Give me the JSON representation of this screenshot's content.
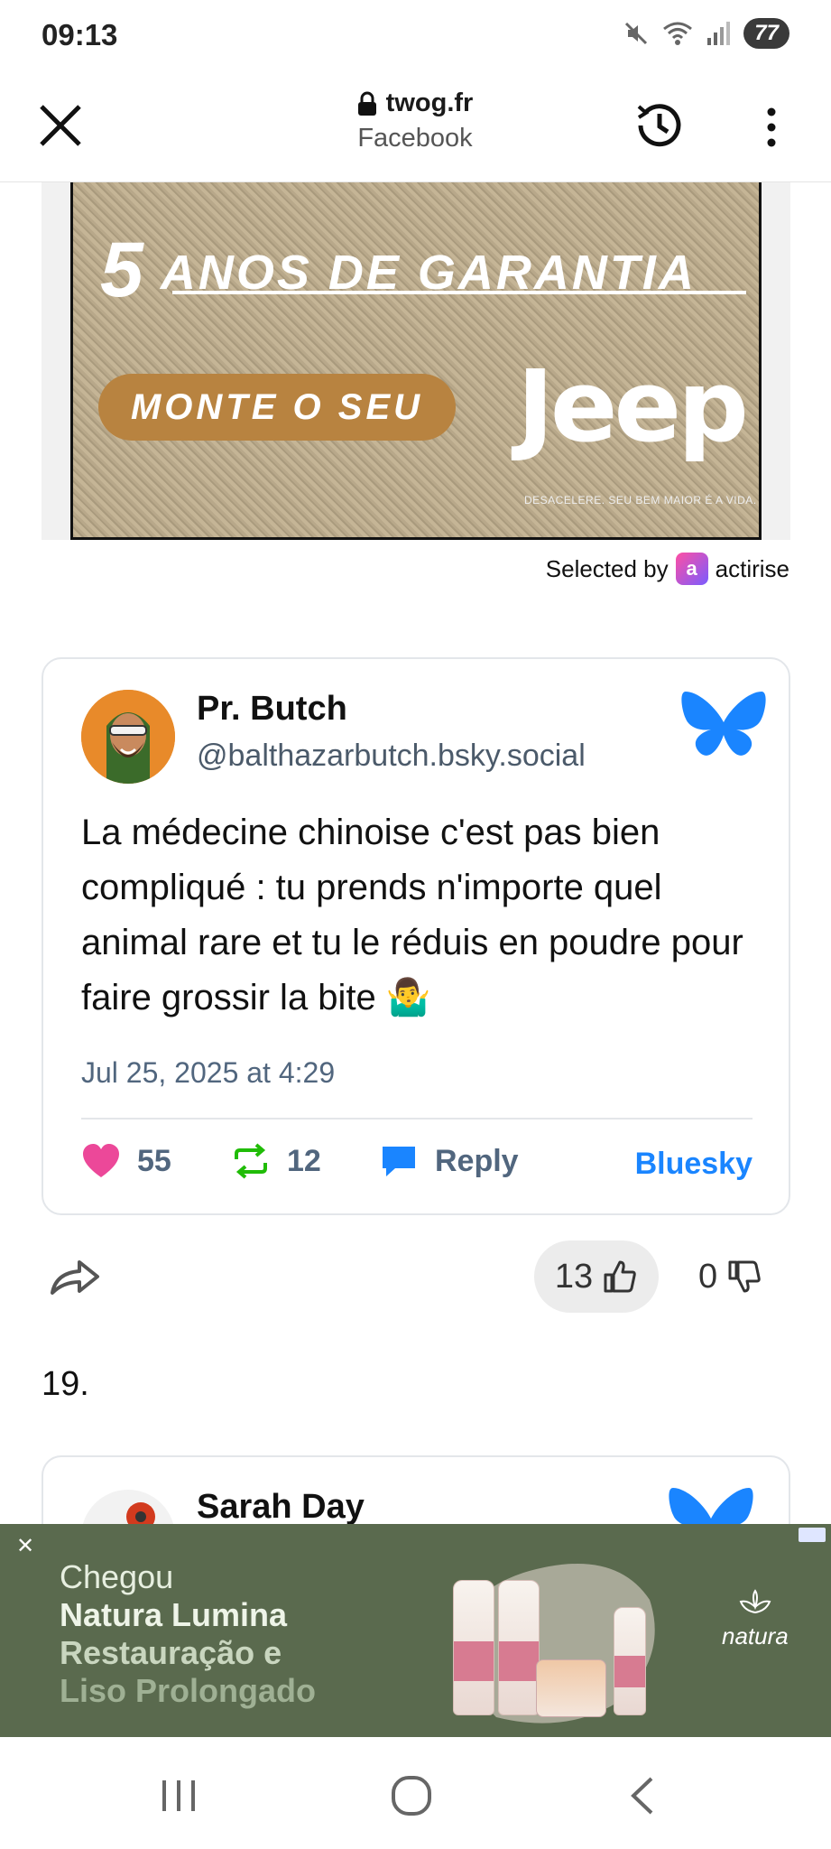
{
  "status": {
    "time": "09:13",
    "battery": "77"
  },
  "browser": {
    "domain": "twog.fr",
    "source": "Facebook"
  },
  "ad_banner": {
    "headline_number": "5",
    "headline_text": "ANOS DE GARANTIA",
    "cta": "MONTE O SEU",
    "brand": "Jeep",
    "fine_print": "DESACELERE. SEU BEM MAIOR É A VIDA."
  },
  "ad_attribution": {
    "prefix": "Selected by",
    "brand": "actirise"
  },
  "post": {
    "author_name": "Pr. Butch",
    "author_handle": "@balthazarbutch.bsky.social",
    "text": "La médecine chinoise c'est pas bien compliqué : tu prends n'importe quel animal rare et tu le réduis en poudre pour faire grossir la bite 🤷‍♂️",
    "date": "Jul 25, 2025 at 4:29",
    "likes": "55",
    "reposts": "12",
    "reply_label": "Reply",
    "platform_link": "Bluesky"
  },
  "votes": {
    "up": "13",
    "down": "0"
  },
  "item_number": "19.",
  "next_post": {
    "author_name": "Sarah Day"
  },
  "bottom_ad": {
    "line1": "Chegou",
    "line2": "Natura Lumina",
    "line3": "Restauração e",
    "line4": "Liso Prolongado",
    "brand": "natura"
  },
  "colors": {
    "bluesky_blue": "#1a85ff",
    "like_pink": "#ec4899",
    "repost_green": "#20bc07",
    "ad_cta": "#b88340"
  }
}
